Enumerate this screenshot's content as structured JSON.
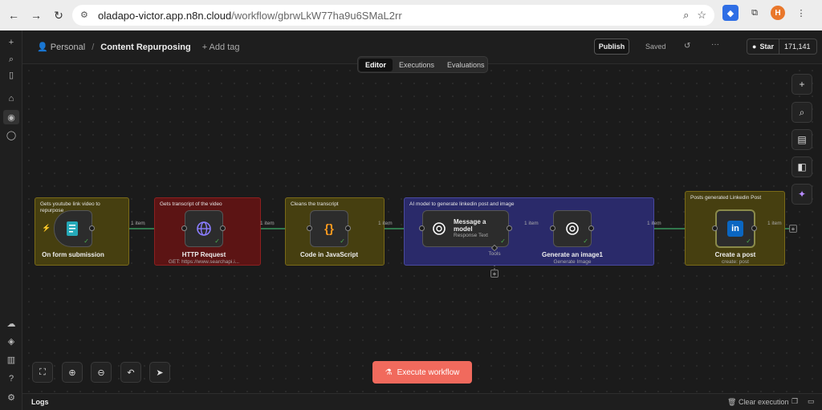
{
  "browser": {
    "url_host": "oladapo-victor.app.n8n.cloud",
    "url_path": "/workflow/gbrwLkW77ha9u6SMaL2rr",
    "avatar_letter": "H"
  },
  "topbar": {
    "workspace": "Personal",
    "workflow_title": "Content Repurposing",
    "add_tag": "+ Add tag",
    "publish": "Publish",
    "saved": "Saved",
    "star_label": "Star",
    "star_count": "171,141"
  },
  "tabs": [
    "Editor",
    "Executions",
    "Evaluations"
  ],
  "stickies": {
    "s1": "Gets youtube link video to repurpose",
    "s2": "Gets transcript of the video",
    "s3": "Cleans the transcript",
    "s4": "AI model to generate linkedin post and image",
    "s5": "Posts generated Linkedin Post"
  },
  "nodes": {
    "form": {
      "label": "On form submission"
    },
    "http": {
      "label": "HTTP Request",
      "sub": "GET: https://www.searchapi.i..."
    },
    "code": {
      "label": "Code in JavaScript"
    },
    "model": {
      "label1": "Message a",
      "label2": "model",
      "sub": "Response Text",
      "tools": "Tools"
    },
    "image": {
      "label": "Generate an image1",
      "sub": "Generate Image"
    },
    "linkedin": {
      "label": "Create a post",
      "sub": "create: post"
    }
  },
  "edges": {
    "item_label": "1 item"
  },
  "execute": "Execute workflow",
  "logs": {
    "label": "Logs",
    "clear": "Clear execution"
  },
  "colors": {
    "sticky_yellow": "#463f10",
    "sticky_red": "#5c1414",
    "sticky_blue": "#2a2a6a",
    "edge": "#3fae6a",
    "execute": "#f16a5d"
  }
}
